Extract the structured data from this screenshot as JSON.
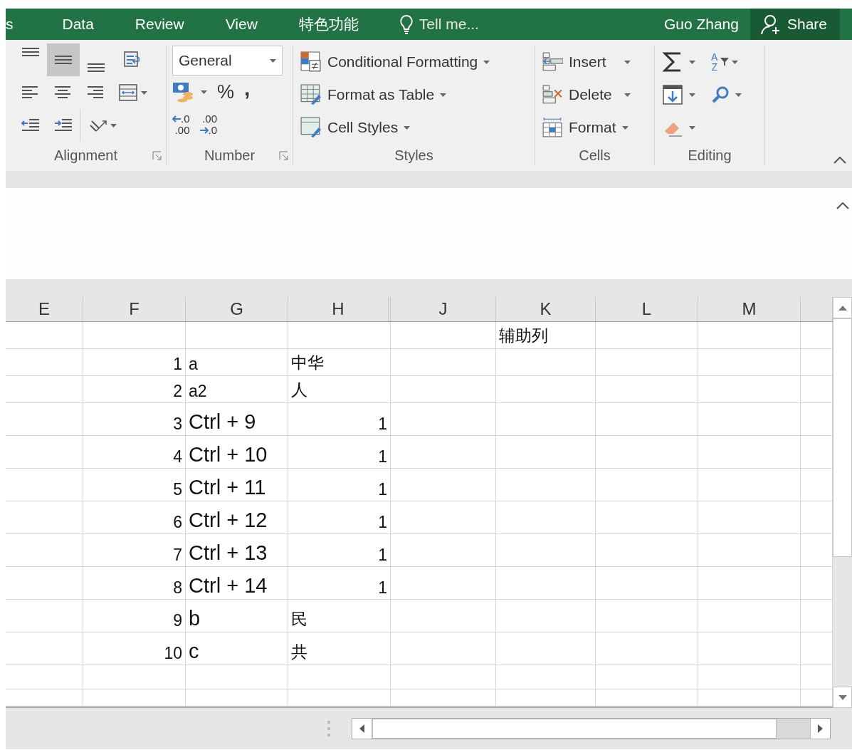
{
  "tabs": [
    {
      "label": "s",
      "selected": false
    },
    {
      "label": "Data",
      "selected": false
    },
    {
      "label": "Review",
      "selected": false
    },
    {
      "label": "View",
      "selected": false
    },
    {
      "label": "特色功能",
      "selected": false
    }
  ],
  "tell_me": {
    "placeholder": "Tell me..."
  },
  "user": "Guo Zhang",
  "share": "Share",
  "alignment": {
    "label": "Alignment",
    "buttons": [
      {
        "kind": "top",
        "selected": false
      },
      {
        "kind": "middle",
        "selected": true
      },
      {
        "kind": "bottom",
        "selected": false
      },
      {
        "kind": "wrap",
        "selected": false
      },
      {
        "kind": "left",
        "selected": false
      },
      {
        "kind": "center",
        "selected": false
      },
      {
        "kind": "right",
        "selected": false
      },
      {
        "kind": "merge",
        "selected": false
      },
      {
        "kind": "outdent",
        "selected": false
      },
      {
        "kind": "indent",
        "selected": false
      },
      {
        "kind": "orientation",
        "selected": false
      }
    ]
  },
  "number": {
    "label": "Number",
    "format": "General",
    "percent": "%",
    "comma": ",",
    "decimals": [
      {
        "kind": "increase",
        "lines": [
          ".0",
          ".00"
        ]
      },
      {
        "kind": "decrease",
        "lines": [
          ".00",
          ".0"
        ]
      }
    ]
  },
  "styles": {
    "label": "Styles",
    "buttons": [
      {
        "kind": "conditional",
        "label": "Conditional Formatting"
      },
      {
        "kind": "table",
        "label": "Format as Table"
      },
      {
        "kind": "cellstyles",
        "label": "Cell Styles"
      }
    ]
  },
  "cells": {
    "label": "Cells",
    "buttons": [
      {
        "kind": "insert",
        "label": "Insert"
      },
      {
        "kind": "delete",
        "label": "Delete"
      },
      {
        "kind": "format",
        "label": "Format"
      }
    ]
  },
  "editing": {
    "label": "Editing",
    "sort_letters": [
      "A",
      "Z"
    ]
  },
  "columns": [
    "E",
    "F",
    "G",
    "H",
    "J",
    "K",
    "L",
    "M"
  ],
  "rows": [
    {
      "K": {
        "text": "辅助列",
        "kind": "text"
      }
    },
    {
      "F": {
        "text": "1",
        "kind": "number"
      },
      "G": {
        "text": "a",
        "kind": "text"
      },
      "H": {
        "text": "中华",
        "kind": "text"
      }
    },
    {
      "F": {
        "text": "2",
        "kind": "number"
      },
      "G": {
        "text": "a2",
        "kind": "text"
      },
      "H": {
        "text": "人",
        "kind": "text"
      }
    },
    {
      "F": {
        "text": "3",
        "kind": "number"
      },
      "G": {
        "text": "Ctrl + 9",
        "kind": "text"
      },
      "H": {
        "text": "1",
        "kind": "number"
      }
    },
    {
      "F": {
        "text": "4",
        "kind": "number"
      },
      "G": {
        "text": "Ctrl + 10",
        "kind": "text"
      },
      "H": {
        "text": "1",
        "kind": "number"
      }
    },
    {
      "F": {
        "text": "5",
        "kind": "number"
      },
      "G": {
        "text": "Ctrl + 11",
        "kind": "text"
      },
      "H": {
        "text": "1",
        "kind": "number"
      }
    },
    {
      "F": {
        "text": "6",
        "kind": "number"
      },
      "G": {
        "text": "Ctrl + 12",
        "kind": "text"
      },
      "H": {
        "text": "1",
        "kind": "number"
      }
    },
    {
      "F": {
        "text": "7",
        "kind": "number"
      },
      "G": {
        "text": "Ctrl + 13",
        "kind": "text"
      },
      "H": {
        "text": "1",
        "kind": "number"
      }
    },
    {
      "F": {
        "text": "8",
        "kind": "number"
      },
      "G": {
        "text": "Ctrl + 14",
        "kind": "text"
      },
      "H": {
        "text": "1",
        "kind": "number"
      }
    },
    {
      "F": {
        "text": "9",
        "kind": "number"
      },
      "G": {
        "text": "b",
        "kind": "text"
      },
      "H": {
        "text": "民",
        "kind": "text"
      }
    },
    {
      "F": {
        "text": "10",
        "kind": "number"
      },
      "G": {
        "text": "c",
        "kind": "text"
      },
      "H": {
        "text": "共",
        "kind": "text"
      }
    }
  ]
}
